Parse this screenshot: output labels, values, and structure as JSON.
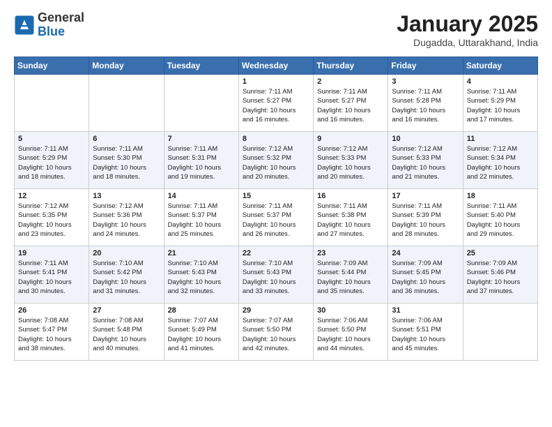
{
  "header": {
    "logo_general": "General",
    "logo_blue": "Blue",
    "month_title": "January 2025",
    "subtitle": "Dugadda, Uttarakhand, India"
  },
  "days_of_week": [
    "Sunday",
    "Monday",
    "Tuesday",
    "Wednesday",
    "Thursday",
    "Friday",
    "Saturday"
  ],
  "weeks": [
    [
      {
        "day": "",
        "info": ""
      },
      {
        "day": "",
        "info": ""
      },
      {
        "day": "",
        "info": ""
      },
      {
        "day": "1",
        "info": "Sunrise: 7:11 AM\nSunset: 5:27 PM\nDaylight: 10 hours\nand 16 minutes."
      },
      {
        "day": "2",
        "info": "Sunrise: 7:11 AM\nSunset: 5:27 PM\nDaylight: 10 hours\nand 16 minutes."
      },
      {
        "day": "3",
        "info": "Sunrise: 7:11 AM\nSunset: 5:28 PM\nDaylight: 10 hours\nand 16 minutes."
      },
      {
        "day": "4",
        "info": "Sunrise: 7:11 AM\nSunset: 5:29 PM\nDaylight: 10 hours\nand 17 minutes."
      }
    ],
    [
      {
        "day": "5",
        "info": "Sunrise: 7:11 AM\nSunset: 5:29 PM\nDaylight: 10 hours\nand 18 minutes."
      },
      {
        "day": "6",
        "info": "Sunrise: 7:11 AM\nSunset: 5:30 PM\nDaylight: 10 hours\nand 18 minutes."
      },
      {
        "day": "7",
        "info": "Sunrise: 7:11 AM\nSunset: 5:31 PM\nDaylight: 10 hours\nand 19 minutes."
      },
      {
        "day": "8",
        "info": "Sunrise: 7:12 AM\nSunset: 5:32 PM\nDaylight: 10 hours\nand 20 minutes."
      },
      {
        "day": "9",
        "info": "Sunrise: 7:12 AM\nSunset: 5:33 PM\nDaylight: 10 hours\nand 20 minutes."
      },
      {
        "day": "10",
        "info": "Sunrise: 7:12 AM\nSunset: 5:33 PM\nDaylight: 10 hours\nand 21 minutes."
      },
      {
        "day": "11",
        "info": "Sunrise: 7:12 AM\nSunset: 5:34 PM\nDaylight: 10 hours\nand 22 minutes."
      }
    ],
    [
      {
        "day": "12",
        "info": "Sunrise: 7:12 AM\nSunset: 5:35 PM\nDaylight: 10 hours\nand 23 minutes."
      },
      {
        "day": "13",
        "info": "Sunrise: 7:12 AM\nSunset: 5:36 PM\nDaylight: 10 hours\nand 24 minutes."
      },
      {
        "day": "14",
        "info": "Sunrise: 7:11 AM\nSunset: 5:37 PM\nDaylight: 10 hours\nand 25 minutes."
      },
      {
        "day": "15",
        "info": "Sunrise: 7:11 AM\nSunset: 5:37 PM\nDaylight: 10 hours\nand 26 minutes."
      },
      {
        "day": "16",
        "info": "Sunrise: 7:11 AM\nSunset: 5:38 PM\nDaylight: 10 hours\nand 27 minutes."
      },
      {
        "day": "17",
        "info": "Sunrise: 7:11 AM\nSunset: 5:39 PM\nDaylight: 10 hours\nand 28 minutes."
      },
      {
        "day": "18",
        "info": "Sunrise: 7:11 AM\nSunset: 5:40 PM\nDaylight: 10 hours\nand 29 minutes."
      }
    ],
    [
      {
        "day": "19",
        "info": "Sunrise: 7:11 AM\nSunset: 5:41 PM\nDaylight: 10 hours\nand 30 minutes."
      },
      {
        "day": "20",
        "info": "Sunrise: 7:10 AM\nSunset: 5:42 PM\nDaylight: 10 hours\nand 31 minutes."
      },
      {
        "day": "21",
        "info": "Sunrise: 7:10 AM\nSunset: 5:43 PM\nDaylight: 10 hours\nand 32 minutes."
      },
      {
        "day": "22",
        "info": "Sunrise: 7:10 AM\nSunset: 5:43 PM\nDaylight: 10 hours\nand 33 minutes."
      },
      {
        "day": "23",
        "info": "Sunrise: 7:09 AM\nSunset: 5:44 PM\nDaylight: 10 hours\nand 35 minutes."
      },
      {
        "day": "24",
        "info": "Sunrise: 7:09 AM\nSunset: 5:45 PM\nDaylight: 10 hours\nand 36 minutes."
      },
      {
        "day": "25",
        "info": "Sunrise: 7:09 AM\nSunset: 5:46 PM\nDaylight: 10 hours\nand 37 minutes."
      }
    ],
    [
      {
        "day": "26",
        "info": "Sunrise: 7:08 AM\nSunset: 5:47 PM\nDaylight: 10 hours\nand 38 minutes."
      },
      {
        "day": "27",
        "info": "Sunrise: 7:08 AM\nSunset: 5:48 PM\nDaylight: 10 hours\nand 40 minutes."
      },
      {
        "day": "28",
        "info": "Sunrise: 7:07 AM\nSunset: 5:49 PM\nDaylight: 10 hours\nand 41 minutes."
      },
      {
        "day": "29",
        "info": "Sunrise: 7:07 AM\nSunset: 5:50 PM\nDaylight: 10 hours\nand 42 minutes."
      },
      {
        "day": "30",
        "info": "Sunrise: 7:06 AM\nSunset: 5:50 PM\nDaylight: 10 hours\nand 44 minutes."
      },
      {
        "day": "31",
        "info": "Sunrise: 7:06 AM\nSunset: 5:51 PM\nDaylight: 10 hours\nand 45 minutes."
      },
      {
        "day": "",
        "info": ""
      }
    ]
  ]
}
